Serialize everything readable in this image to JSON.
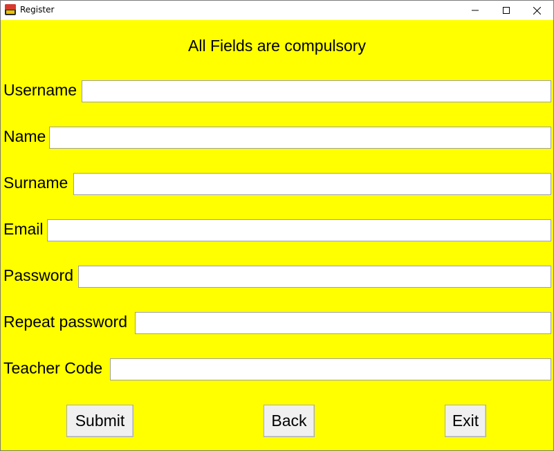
{
  "window": {
    "title": "Register",
    "icon": "java-app-icon",
    "controls": {
      "minimize": "minimize-icon",
      "maximize": "maximize-icon",
      "close": "close-icon"
    }
  },
  "form": {
    "heading": "All Fields are compulsory",
    "fields": [
      {
        "label": "Username",
        "value": "",
        "placeholder": ""
      },
      {
        "label": "Name",
        "value": "",
        "placeholder": ""
      },
      {
        "label": "Surname",
        "value": "",
        "placeholder": ""
      },
      {
        "label": "Email",
        "value": "",
        "placeholder": ""
      },
      {
        "label": "Password",
        "value": "",
        "placeholder": ""
      },
      {
        "label": "Repeat password",
        "value": "",
        "placeholder": ""
      },
      {
        "label": "Teacher Code",
        "value": "",
        "placeholder": ""
      }
    ],
    "buttons": {
      "submit": "Submit",
      "back": "Back",
      "exit": "Exit"
    }
  },
  "colors": {
    "background": "#ffff00",
    "input_background": "#ffffff",
    "button_background": "#f0f0f0",
    "text": "#000000"
  }
}
